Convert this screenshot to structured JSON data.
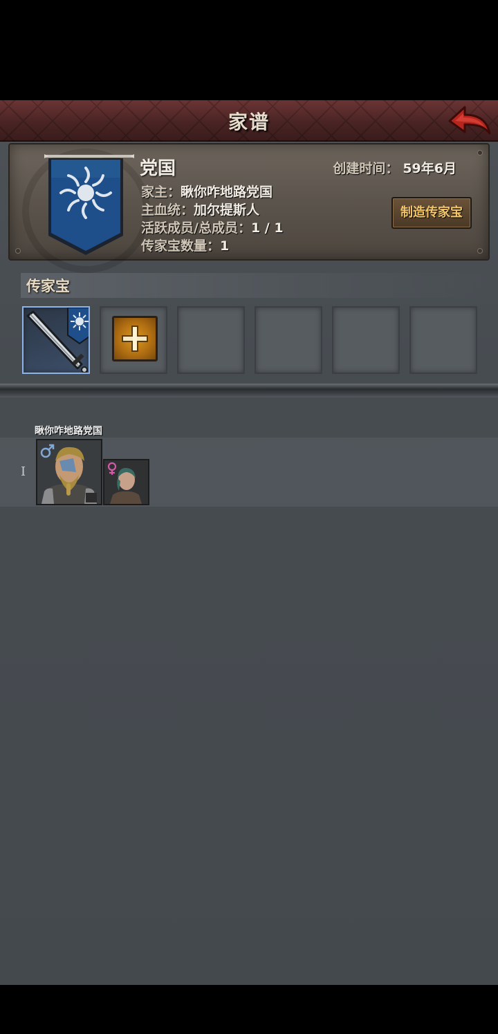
{
  "header": {
    "title": "家谱"
  },
  "family": {
    "name": "党国",
    "created_label": "创建时间：",
    "created_value": "59年6月",
    "patriarch_label": "家主：",
    "patriarch_value": "瞅你咋地路党国",
    "bloodline_label": "主血统：",
    "bloodline_value": "加尔提斯人",
    "members_label": "活跃成员/总成员：",
    "members_value": "1 / 1",
    "heirloom_count_label": "传家宝数量：",
    "heirloom_count_value": "1",
    "make_heirloom_button": "制造传家宝"
  },
  "heirlooms": {
    "title": "传家宝",
    "slots": [
      {
        "type": "item",
        "icon": "sword-icon",
        "selected": true
      },
      {
        "type": "add",
        "icon": "plus-icon"
      },
      {
        "type": "empty"
      },
      {
        "type": "empty"
      },
      {
        "type": "empty"
      },
      {
        "type": "empty"
      }
    ]
  },
  "tree": {
    "member_name": "瞅你咋地路党国",
    "generation_label": "I",
    "male_icon": "male-symbol-icon",
    "female_icon": "female-symbol-icon"
  },
  "colors": {
    "header_red": "#6b3434",
    "card_brown": "#5b544c",
    "banner_blue": "#1f4f8a",
    "button_text": "#f4c66a",
    "selected_border": "#8fb4ea",
    "plus_orange": "#d89a25"
  }
}
